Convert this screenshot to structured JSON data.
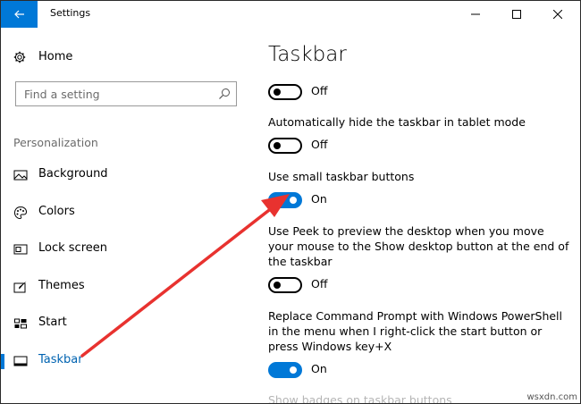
{
  "window": {
    "title": "Settings"
  },
  "sidebar": {
    "home_label": "Home",
    "search_placeholder": "Find a setting",
    "section_label": "Personalization",
    "items": [
      {
        "label": "Background",
        "icon": "picture-icon"
      },
      {
        "label": "Colors",
        "icon": "palette-icon"
      },
      {
        "label": "Lock screen",
        "icon": "lock-screen-icon"
      },
      {
        "label": "Themes",
        "icon": "brush-icon"
      },
      {
        "label": "Start",
        "icon": "start-grid-icon"
      },
      {
        "label": "Taskbar",
        "icon": "taskbar-icon",
        "active": true
      }
    ]
  },
  "content": {
    "page_title": "Taskbar",
    "settings": [
      {
        "label": "",
        "state": "Off",
        "on": false
      },
      {
        "label": "Automatically hide the taskbar in tablet mode",
        "state": "Off",
        "on": false
      },
      {
        "label": "Use small taskbar buttons",
        "state": "On",
        "on": true
      },
      {
        "label": "Use Peek to preview the desktop when you move your mouse to the Show desktop button at the end of the taskbar",
        "state": "Off",
        "on": false
      },
      {
        "label": "Replace Command Prompt with Windows PowerShell in the menu when I right-click the start button or press Windows key+X",
        "state": "On",
        "on": true
      }
    ],
    "cut_off_label": "Show badges on taskbar buttons"
  },
  "watermark": "wsxdn.com",
  "colors": {
    "accent": "#0078d7",
    "annotation_arrow": "#e8322f"
  }
}
